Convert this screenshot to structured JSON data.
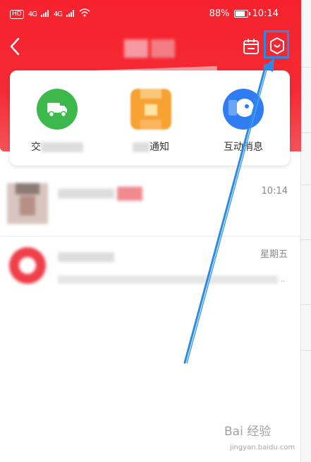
{
  "status_bar": {
    "hd": "HD",
    "signal_1": "4G",
    "signal_2": "4G",
    "battery": "88%",
    "time": "10:14"
  },
  "header": {
    "back_icon": "chevron-left-icon",
    "calendar_icon": "calendar-icon",
    "settings_icon": "settings-icon"
  },
  "shortcuts": [
    {
      "label": "交",
      "icon": "truck-icon",
      "color": "#3cb94a"
    },
    {
      "label": "通知",
      "icon": "bell-icon",
      "color": "#f7a233"
    },
    {
      "label": "互动消息",
      "icon": "chat-icon",
      "color": "#2f7cf3"
    }
  ],
  "messages": [
    {
      "time": "10:14"
    },
    {
      "time": "星期五"
    }
  ],
  "watermark": {
    "text": "Bai 经验",
    "url": "jingyan.baidu.com"
  },
  "colors": {
    "brand_red": "#f5222d",
    "highlight_blue": "#2b8ae8"
  }
}
